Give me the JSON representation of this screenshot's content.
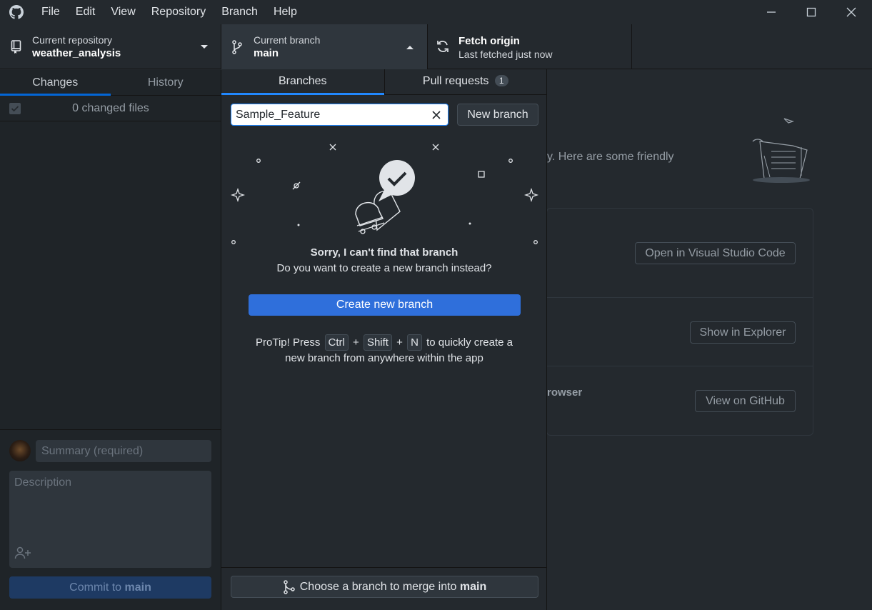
{
  "menu": {
    "items": [
      "File",
      "Edit",
      "View",
      "Repository",
      "Branch",
      "Help"
    ]
  },
  "toolbar": {
    "repo_label": "Current repository",
    "repo_name": "weather_analysis",
    "branch_label": "Current branch",
    "branch_name": "main",
    "fetch_title": "Fetch origin",
    "fetch_status": "Last fetched just now"
  },
  "sidebar": {
    "tab_changes": "Changes",
    "tab_history": "History",
    "changed_files": "0 changed files",
    "summary_placeholder": "Summary (required)",
    "description_placeholder": "Description",
    "commit_prefix": "Commit to ",
    "commit_branch": "main"
  },
  "dropdown": {
    "tab_branches": "Branches",
    "tab_pull_requests": "Pull requests",
    "pr_count": "1",
    "filter_value": "Sample_Feature",
    "new_branch_label": "New branch",
    "empty_title": "Sorry, I can't find that branch",
    "empty_subtitle": "Do you want to create a new branch instead?",
    "create_button": "Create new branch",
    "protip_prefix": "ProTip! Press",
    "key_ctrl": "Ctrl",
    "key_shift": "Shift",
    "key_n": "N",
    "plus": "+",
    "protip_suffix": "to quickly create a",
    "protip_line2": "new branch from anywhere within the app",
    "merge_prefix": "Choose a branch to merge into ",
    "merge_branch": "main"
  },
  "main": {
    "partial_text": "y. Here are some friendly",
    "open_vscode": "Open in Visual Studio Code",
    "show_explorer": "Show in Explorer",
    "partial_browser": "rowser",
    "view_github": "View on GitHub"
  },
  "colors": {
    "accent_blue": "#2f6fdb",
    "background": "#24292e",
    "sidebar_bg": "#1f2428"
  }
}
